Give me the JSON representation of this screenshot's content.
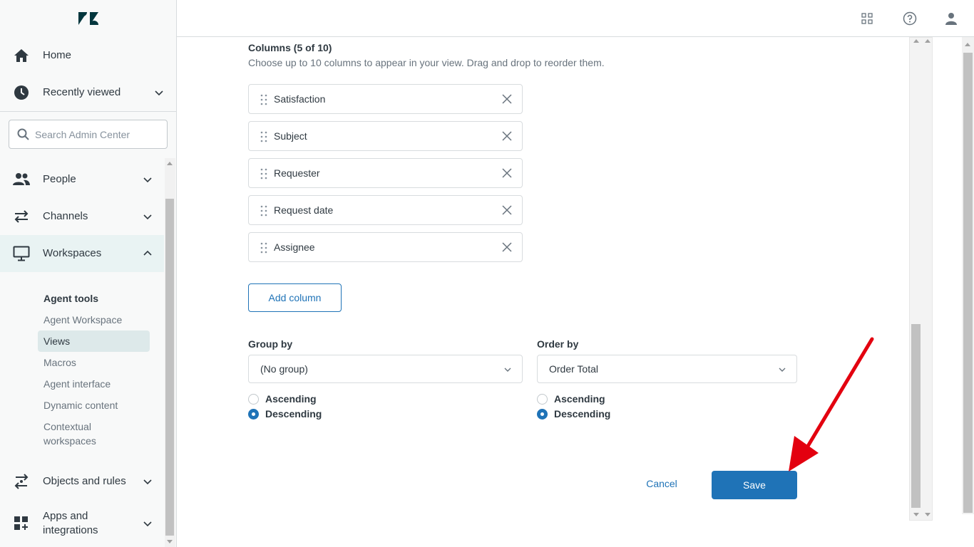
{
  "sidebar": {
    "logo": "zendesk-logo",
    "items": [
      {
        "label": "Home",
        "icon": "home-icon"
      },
      {
        "label": "Recently viewed",
        "icon": "clock-icon"
      },
      {
        "label": "People",
        "icon": "people-icon"
      },
      {
        "label": "Channels",
        "icon": "channels-icon"
      },
      {
        "label": "Workspaces",
        "icon": "monitor-icon"
      },
      {
        "label": "Objects and rules",
        "icon": "objects-rules-icon"
      },
      {
        "label": "Apps and integrations",
        "icon": "apps-icon"
      }
    ],
    "search": {
      "placeholder": "Search Admin Center"
    },
    "workspaces_sub": {
      "heading": "Agent tools",
      "items": [
        "Agent Workspace",
        "Views",
        "Macros",
        "Agent interface",
        "Dynamic content",
        "Contextual workspaces"
      ],
      "active": "Views"
    }
  },
  "topbar": {
    "icons": [
      "products-grid-icon",
      "help-icon",
      "user-icon"
    ]
  },
  "columns": {
    "title": "Columns (5 of 10)",
    "description": "Choose up to 10 columns to appear in your view. Drag and drop to reorder them.",
    "items": [
      "Satisfaction",
      "Subject",
      "Requester",
      "Request date",
      "Assignee"
    ],
    "add_label": "Add column"
  },
  "group_by": {
    "label": "Group by",
    "value": "(No group)",
    "ascending": "Ascending",
    "descending": "Descending",
    "selected": "Descending"
  },
  "order_by": {
    "label": "Order by",
    "value": "Order Total",
    "ascending": "Ascending",
    "descending": "Descending",
    "selected": "Descending"
  },
  "actions": {
    "cancel": "Cancel",
    "save": "Save"
  },
  "colors": {
    "accent": "#1f73b7",
    "active_nav": "#e9f3f3",
    "annotation": "#e3000f"
  }
}
